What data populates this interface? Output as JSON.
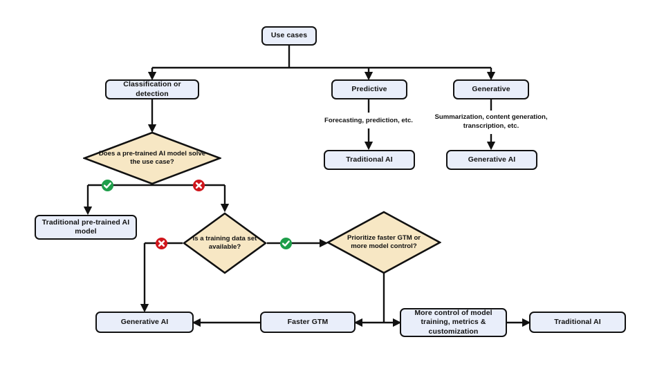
{
  "diagram": {
    "title": "AI use case decision flowchart",
    "colors": {
      "box_fill": "#E9EEFA",
      "diamond_fill": "#F7E7C4",
      "stroke": "#111111",
      "yes_marker": "#1E9E4A",
      "no_marker": "#D0161C"
    },
    "nodes": {
      "use_cases": "Use cases",
      "classification_or_detection": "Classification or detection",
      "predictive": "Predictive",
      "generative": "Generative",
      "predictive_examples": "Forecasting, prediction, etc.",
      "generative_examples": "Summarization, content generation, transcription, etc.",
      "predictive_outcome": "Traditional AI",
      "generative_outcome": "Generative AI",
      "pretrained_question": "Does a pre-trained AI model solve the use case?",
      "traditional_pretrained_model": "Traditional pre-trained AI model",
      "training_data_question": "Is a training data set available?",
      "priority_question": "Prioritize faster GTM or more model control?",
      "generative_ai_outcome": "Generative AI",
      "faster_gtm": "Faster GTM",
      "more_control": "More control of model training, metrics & customization",
      "traditional_ai_outcome": "Traditional AI"
    },
    "markers": {
      "yes": "check-circle-icon",
      "no": "x-circle-icon"
    }
  }
}
